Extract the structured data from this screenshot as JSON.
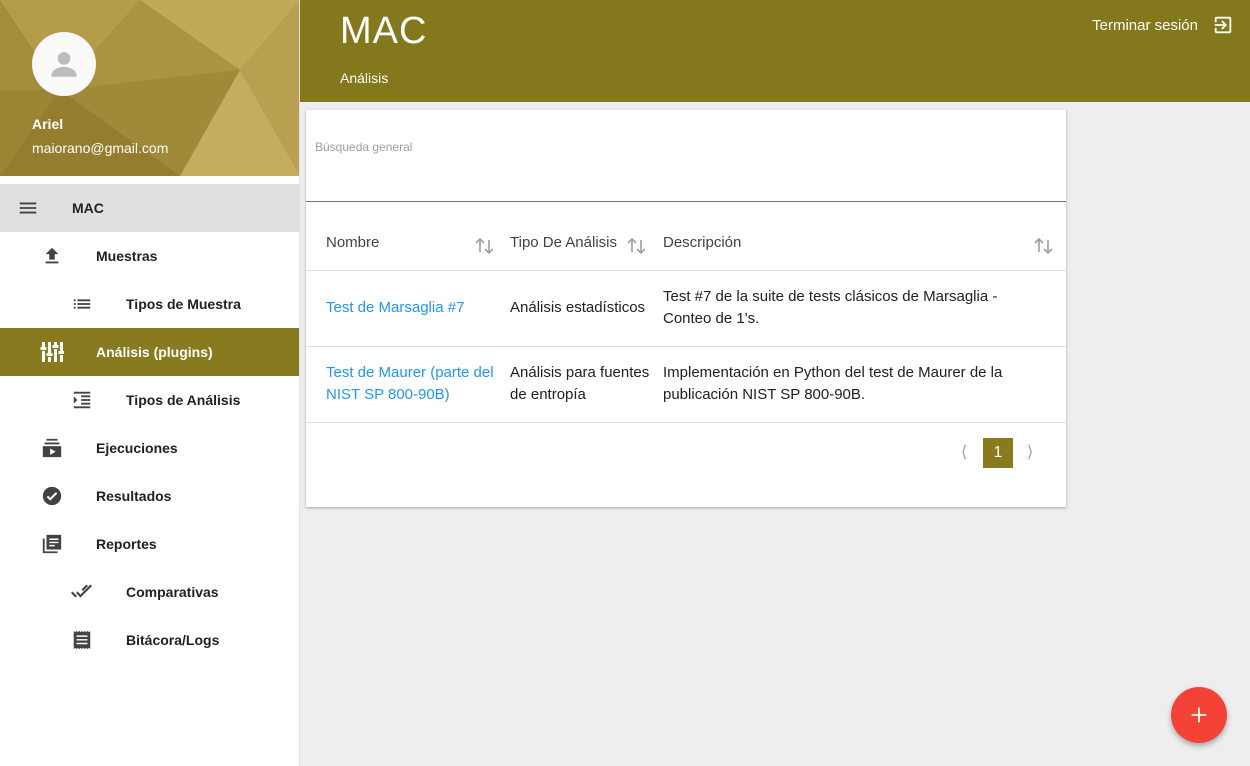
{
  "colors": {
    "brand": "#83781b",
    "active": "#877a1f",
    "link": "#2196f3",
    "fab": "#f44336"
  },
  "user": {
    "name": "Ariel",
    "email": "maiorano@gmail.com"
  },
  "sidebar": {
    "items": [
      {
        "label": "MAC",
        "icon": "menu-icon"
      },
      {
        "label": "Muestras",
        "icon": "upload-icon"
      },
      {
        "label": "Tipos de Muestra",
        "icon": "list-icon"
      },
      {
        "label": "Análisis (plugins)",
        "icon": "tune-icon"
      },
      {
        "label": "Tipos de Análisis",
        "icon": "format-indent-icon"
      },
      {
        "label": "Ejecuciones",
        "icon": "subscriptions-icon"
      },
      {
        "label": "Resultados",
        "icon": "check-circle-icon"
      },
      {
        "label": "Reportes",
        "icon": "library-books-icon"
      },
      {
        "label": "Comparativas",
        "icon": "done-all-icon"
      },
      {
        "label": "Bitácora/Logs",
        "icon": "receipt-icon"
      }
    ]
  },
  "header": {
    "title": "MAC",
    "subtitle": "Análisis",
    "logout_label": "Terminar sesión"
  },
  "search": {
    "label": "Búsqueda general",
    "value": ""
  },
  "table": {
    "columns": [
      "Nombre",
      "Tipo De Análisis",
      "Descripción"
    ],
    "rows": [
      {
        "name_l1": "Test de Marsaglia #7",
        "name_l2": "",
        "type_l1": "Análisis estadísticos",
        "type_l2": "",
        "desc_l1": "Test #7 de la suite de tests clásicos de Marsaglia -",
        "desc_l2": "Conteo de 1's."
      },
      {
        "name_l1": "Test de Maurer (parte del",
        "name_l2": "NIST SP 800-90B)",
        "type_l1": "Análisis para fuentes",
        "type_l2": "de entropía",
        "desc_l1": "Implementación en Python del test de Maurer de la",
        "desc_l2": "publicación NIST SP 800-90B."
      }
    ]
  },
  "pagination": {
    "prev": "⟨",
    "current": "1",
    "next": "⟩"
  },
  "fab": {
    "icon": "add-icon"
  }
}
